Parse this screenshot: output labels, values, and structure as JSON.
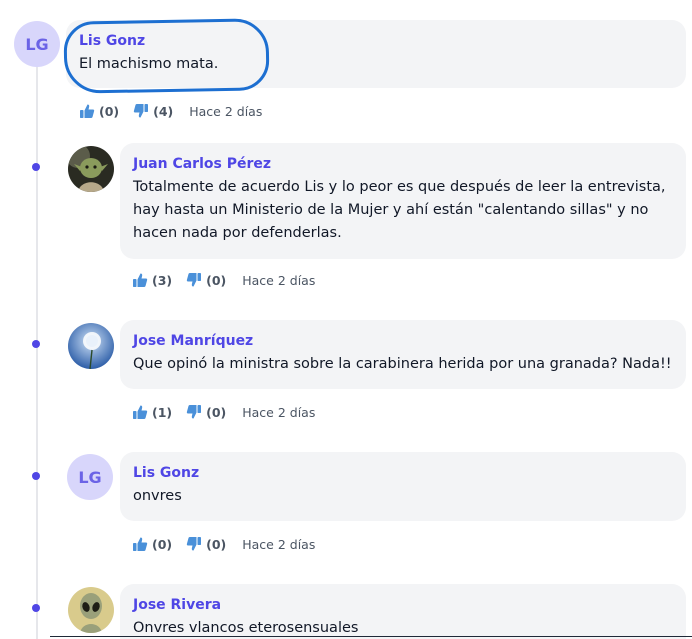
{
  "comments": [
    {
      "author": "Lis Gonz",
      "avatar_initials": "LG",
      "text": "El machismo mata.",
      "likes": "(0)",
      "dislikes": "(4)",
      "time": "Hace 2 días"
    },
    {
      "author": "Juan Carlos Pérez",
      "avatar_image": "yoda-avatar",
      "text": "Totalmente de acuerdo Lis y lo peor es que después de leer la entrevista, hay hasta un Ministerio de la Mujer y ahí están \"calentando sillas\" y no hacen nada por defenderlas.",
      "likes": "(3)",
      "dislikes": "(0)",
      "time": "Hace 2 días"
    },
    {
      "author": "Jose Manríquez",
      "avatar_image": "dandelion-avatar",
      "text": "Que opinó la ministra sobre la carabinera herida por una granada? Nada!!",
      "likes": "(1)",
      "dislikes": "(0)",
      "time": "Hace 2 días"
    },
    {
      "author": "Lis Gonz",
      "avatar_initials": "LG",
      "text": "onvres",
      "likes": "(0)",
      "dislikes": "(0)",
      "time": "Hace 2 días"
    },
    {
      "author": "Jose Rivera",
      "avatar_image": "alien-avatar",
      "text": "Onvres vlancos eterosensuales"
    }
  ],
  "icons": {
    "like": "thumbs-up-icon",
    "dislike": "thumbs-down-icon"
  },
  "colors": {
    "author": "#4f46e5",
    "bubble": "#f3f4f6",
    "thumb": "#4a90d9",
    "highlight": "#1d6fd1"
  }
}
